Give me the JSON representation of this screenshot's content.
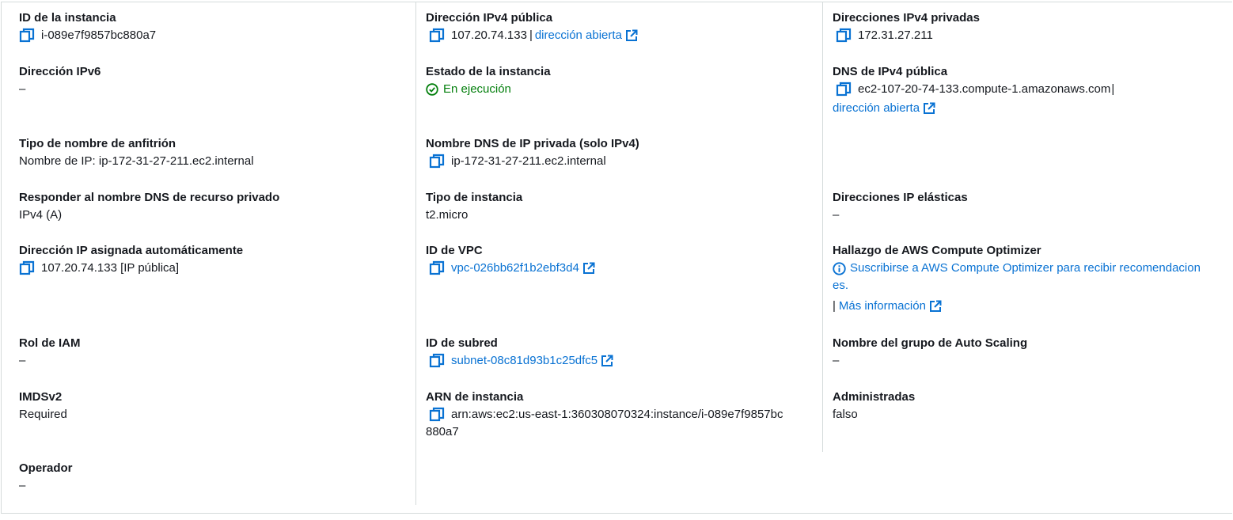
{
  "colors": {
    "link": "#0972d3",
    "success": "#037f0c",
    "text": "#16191f",
    "border": "#d5dbdb"
  },
  "col1": {
    "instance_id": {
      "label": "ID de la instancia",
      "value": "i-089e7f9857bc880a7"
    },
    "ipv6": {
      "label": "Dirección IPv6",
      "value": "–"
    },
    "hostname_type": {
      "label": "Tipo de nombre de anfitrión",
      "value": "Nombre de IP: ip-172-31-27-211.ec2.internal"
    },
    "dns_response": {
      "label": "Responder al nombre DNS de recurso privado",
      "value": "IPv4 (A)"
    },
    "auto_ip": {
      "label": "Dirección IP asignada automáticamente",
      "value": "107.20.74.133 [IP pública]"
    },
    "iam_role": {
      "label": "Rol de IAM",
      "value": "–"
    },
    "imdsv2": {
      "label": "IMDSv2",
      "value": "Required"
    },
    "operator": {
      "label": "Operador",
      "value": "–"
    }
  },
  "col2": {
    "public_ipv4": {
      "label": "Dirección IPv4 pública",
      "value": "107.20.74.133",
      "separator": "|",
      "link": "dirección abierta"
    },
    "state": {
      "label": "Estado de la instancia",
      "value": "En ejecución",
      "icon": "check-circle-icon"
    },
    "private_dns": {
      "label": "Nombre DNS de IP privada (solo IPv4)",
      "value": "ip-172-31-27-211.ec2.internal"
    },
    "instance_type": {
      "label": "Tipo de instancia",
      "value": "t2.micro"
    },
    "vpc": {
      "label": "ID de VPC",
      "value": "vpc-026bb62f1b2ebf3d4"
    },
    "subnet": {
      "label": "ID de subred",
      "value": "subnet-08c81d93b1c25dfc5"
    },
    "arn": {
      "label": "ARN de instancia",
      "value_line1": "arn:aws:ec2:us-east-1:360308070324:instance/i-089e7f9857bc",
      "value_line2": "880a7"
    }
  },
  "col3": {
    "private_ipv4": {
      "label": "Direcciones IPv4 privadas",
      "value": "172.31.27.211"
    },
    "public_dns": {
      "label": "DNS de IPv4 pública",
      "value": "ec2-107-20-74-133.compute-1.amazonaws.com",
      "separator": "|",
      "link": "dirección abierta"
    },
    "elastic_ip": {
      "label": "Direcciones IP elásticas",
      "value": "–"
    },
    "optimizer": {
      "label": "Hallazgo de AWS Compute Optimizer",
      "link_line1": "Suscribirse a AWS Compute Optimizer para recibir recomendacion",
      "link_line2": "es.",
      "separator": "|",
      "more": "Más información"
    },
    "asg": {
      "label": "Nombre del grupo de Auto Scaling",
      "value": "–"
    },
    "managed": {
      "label": "Administradas",
      "value": "falso"
    }
  }
}
